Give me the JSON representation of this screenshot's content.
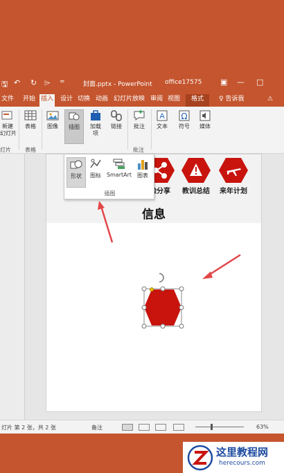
{
  "window": {
    "qat_save": "🖫",
    "qat_undo": "↶",
    "qat_redo": "↻",
    "qat_format": "⌲",
    "qat_more": "=",
    "file_title": "封面.pptx - PowerPoint",
    "user": "office17575",
    "btn_ribbon": "▣",
    "btn_min": "—",
    "btn_max": "□"
  },
  "tabs": [
    {
      "label": "文件"
    },
    {
      "label": "开始"
    },
    {
      "label": "插入"
    },
    {
      "label": "设计"
    },
    {
      "label": "切换"
    },
    {
      "label": "动画"
    },
    {
      "label": "幻灯片放映"
    },
    {
      "label": "审阅"
    },
    {
      "label": "视图"
    },
    {
      "label": "格式"
    },
    {
      "label": "♀ 告诉我"
    },
    {
      "label": "⚠"
    }
  ],
  "ribbon": {
    "new_slide": "新建\n幻灯片",
    "slides_group": "灯片",
    "table": "表格",
    "tables_group": "表格",
    "images": "图像",
    "illustrations": "插图",
    "addins": "加载\n项",
    "links": "链接",
    "comment": "批注",
    "comments_group": "批注",
    "text": "文本",
    "symbols": "符号",
    "media": "媒体"
  },
  "dropdown": {
    "items": [
      {
        "label": "形状"
      },
      {
        "label": "图标"
      },
      {
        "label": "SmartArt"
      },
      {
        "label": "图表"
      }
    ],
    "caption": "插图"
  },
  "slide": {
    "categories": [
      {
        "label": "验分享"
      },
      {
        "label": "教训总结"
      },
      {
        "label": "来年计划"
      }
    ],
    "title": "信息"
  },
  "status": {
    "slide_info": "灯片 第 2 张，共 2 张",
    "notes": "备注",
    "zoom": "63%"
  },
  "watermark": {
    "title": "这里教程网",
    "url": "herecours.com"
  },
  "colors": {
    "brand": "#c4552e",
    "shape_red": "#c8140d"
  }
}
